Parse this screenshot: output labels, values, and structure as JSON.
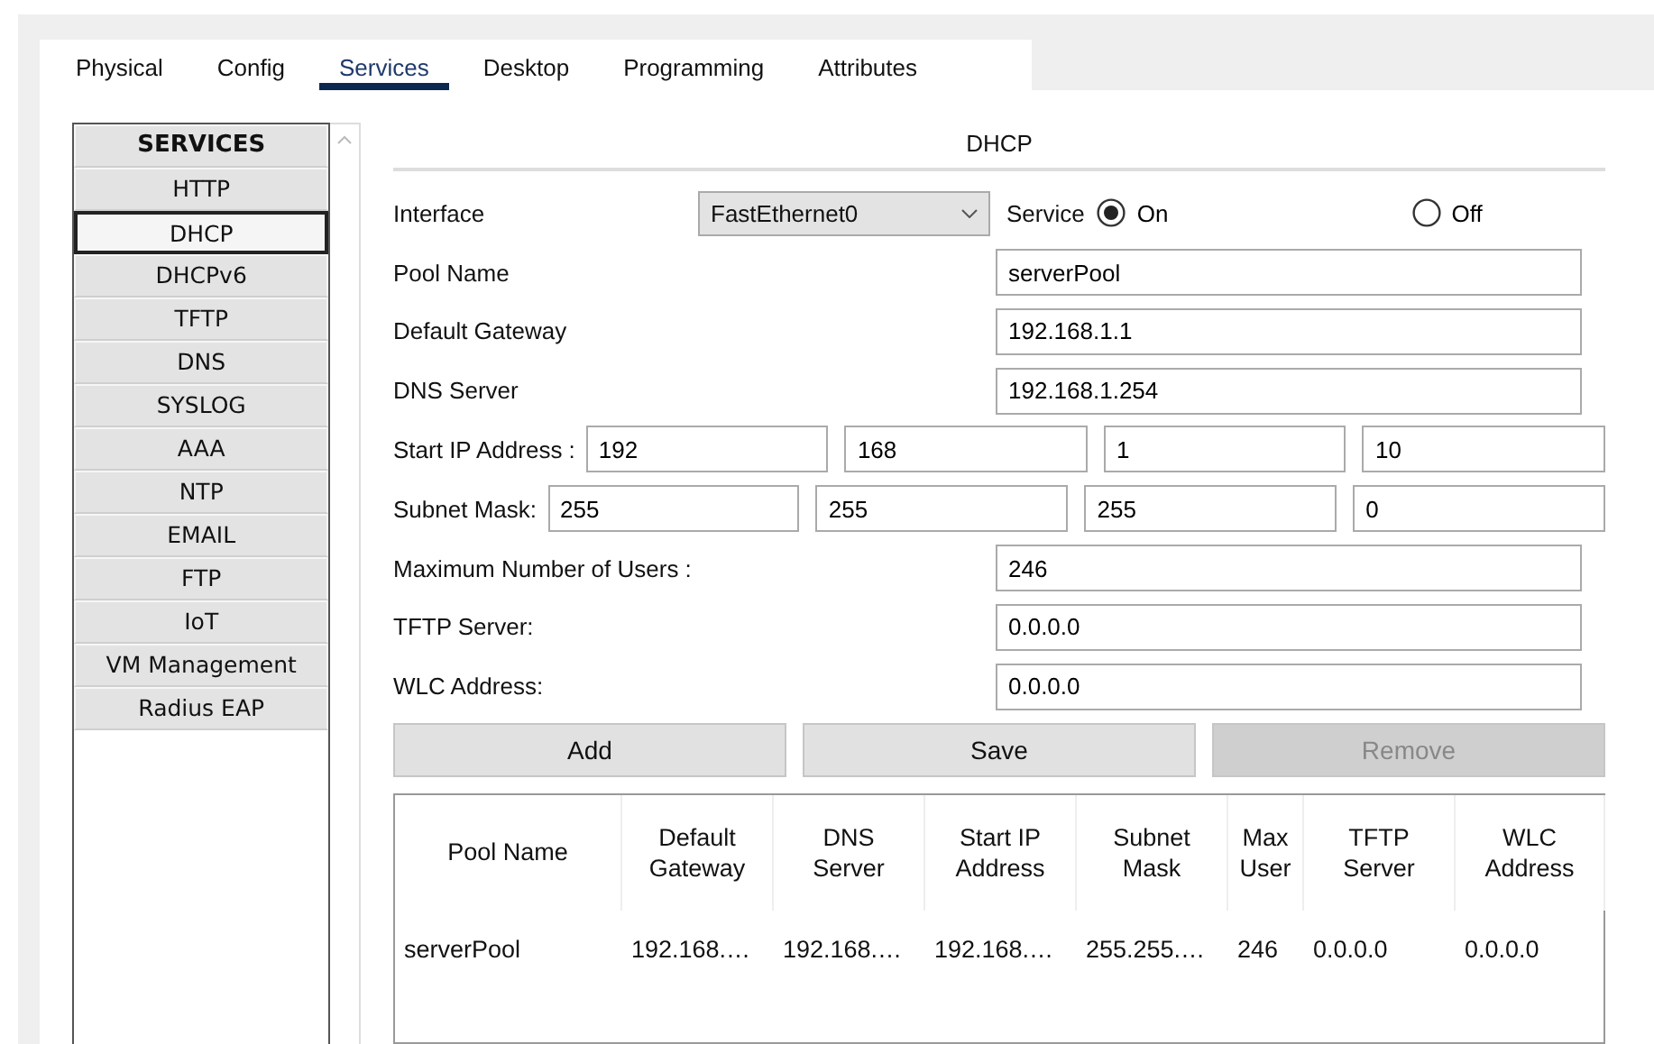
{
  "tabs": [
    {
      "label": "Physical",
      "selected": false
    },
    {
      "label": "Config",
      "selected": false
    },
    {
      "label": "Services",
      "selected": true
    },
    {
      "label": "Desktop",
      "selected": false
    },
    {
      "label": "Programming",
      "selected": false
    },
    {
      "label": "Attributes",
      "selected": false
    }
  ],
  "sidebar": {
    "title": "SERVICES",
    "items": [
      {
        "label": "HTTP",
        "selected": false
      },
      {
        "label": "DHCP",
        "selected": true
      },
      {
        "label": "DHCPv6",
        "selected": false
      },
      {
        "label": "TFTP",
        "selected": false
      },
      {
        "label": "DNS",
        "selected": false
      },
      {
        "label": "SYSLOG",
        "selected": false
      },
      {
        "label": "AAA",
        "selected": false
      },
      {
        "label": "NTP",
        "selected": false
      },
      {
        "label": "EMAIL",
        "selected": false
      },
      {
        "label": "FTP",
        "selected": false
      },
      {
        "label": "IoT",
        "selected": false
      },
      {
        "label": "VM Management",
        "selected": false
      },
      {
        "label": "Radius EAP",
        "selected": false
      }
    ]
  },
  "panel": {
    "title": "DHCP",
    "interface": {
      "label": "Interface",
      "value": "FastEthernet0"
    },
    "service": {
      "label": "Service",
      "options": [
        {
          "label": "On",
          "selected": true
        },
        {
          "label": "Off",
          "selected": false
        }
      ]
    },
    "rows": [
      {
        "kind": "field",
        "label": "Pool Name",
        "value": "serverPool"
      },
      {
        "kind": "field",
        "label": "Default Gateway",
        "value": "192.168.1.1"
      },
      {
        "kind": "field",
        "label": "DNS Server",
        "value": "192.168.1.254"
      },
      {
        "kind": "octets",
        "label": "Start IP Address :",
        "values": [
          "192",
          "168",
          "1",
          "10"
        ]
      },
      {
        "kind": "octets",
        "label": "Subnet Mask:",
        "values": [
          "255",
          "255",
          "255",
          "0"
        ]
      },
      {
        "kind": "field",
        "label": "Maximum Number of Users :",
        "value": "246"
      },
      {
        "kind": "field",
        "label": "TFTP Server:",
        "value": "0.0.0.0"
      },
      {
        "kind": "field",
        "label": "WLC Address:",
        "value": "0.0.0.0"
      }
    ],
    "buttons": [
      {
        "label": "Add",
        "disabled": false
      },
      {
        "label": "Save",
        "disabled": false
      },
      {
        "label": "Remove",
        "disabled": true
      }
    ],
    "table": {
      "columns": [
        "Pool Name",
        "Default Gateway",
        "DNS Server",
        "Start IP Address",
        "Subnet Mask",
        "Max User",
        "TFTP Server",
        "WLC Address"
      ],
      "rows": [
        [
          "serverPool",
          "192.168.…",
          "192.168.…",
          "192.168.…",
          "255.255.…",
          "246",
          "0.0.0.0",
          "0.0.0.0"
        ]
      ]
    }
  }
}
